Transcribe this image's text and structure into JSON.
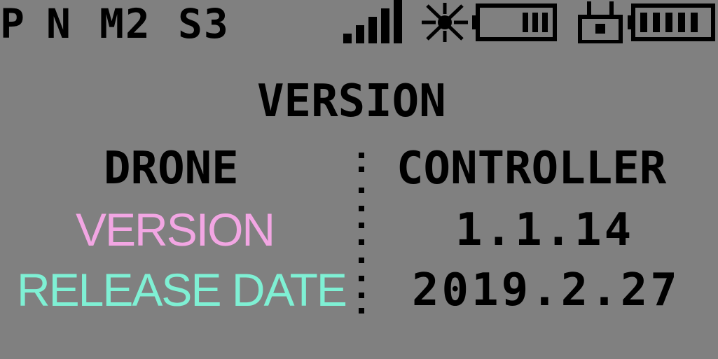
{
  "status_bar": {
    "mode_p": "P",
    "mode_n": "N",
    "mode_m": "M2",
    "mode_s": "S3",
    "icons": [
      "signal-icon",
      "gps-icon",
      "drone-battery-icon",
      "controller-icon",
      "controller-battery-icon"
    ]
  },
  "screen": {
    "title": "VERSION",
    "drone_header": "DRONE",
    "controller_header": "CONTROLLER",
    "controller_version": "1.1.14",
    "controller_release_date": "2019.2.27",
    "drone_version_label": "VERSION",
    "drone_release_date_label": "RELEASE DATE"
  },
  "colors": {
    "lcd_background": "#808080",
    "lcd_pixel": "#000000",
    "version_overlay": "#f2a6e3",
    "release_date_overlay": "#7ff0d4"
  }
}
